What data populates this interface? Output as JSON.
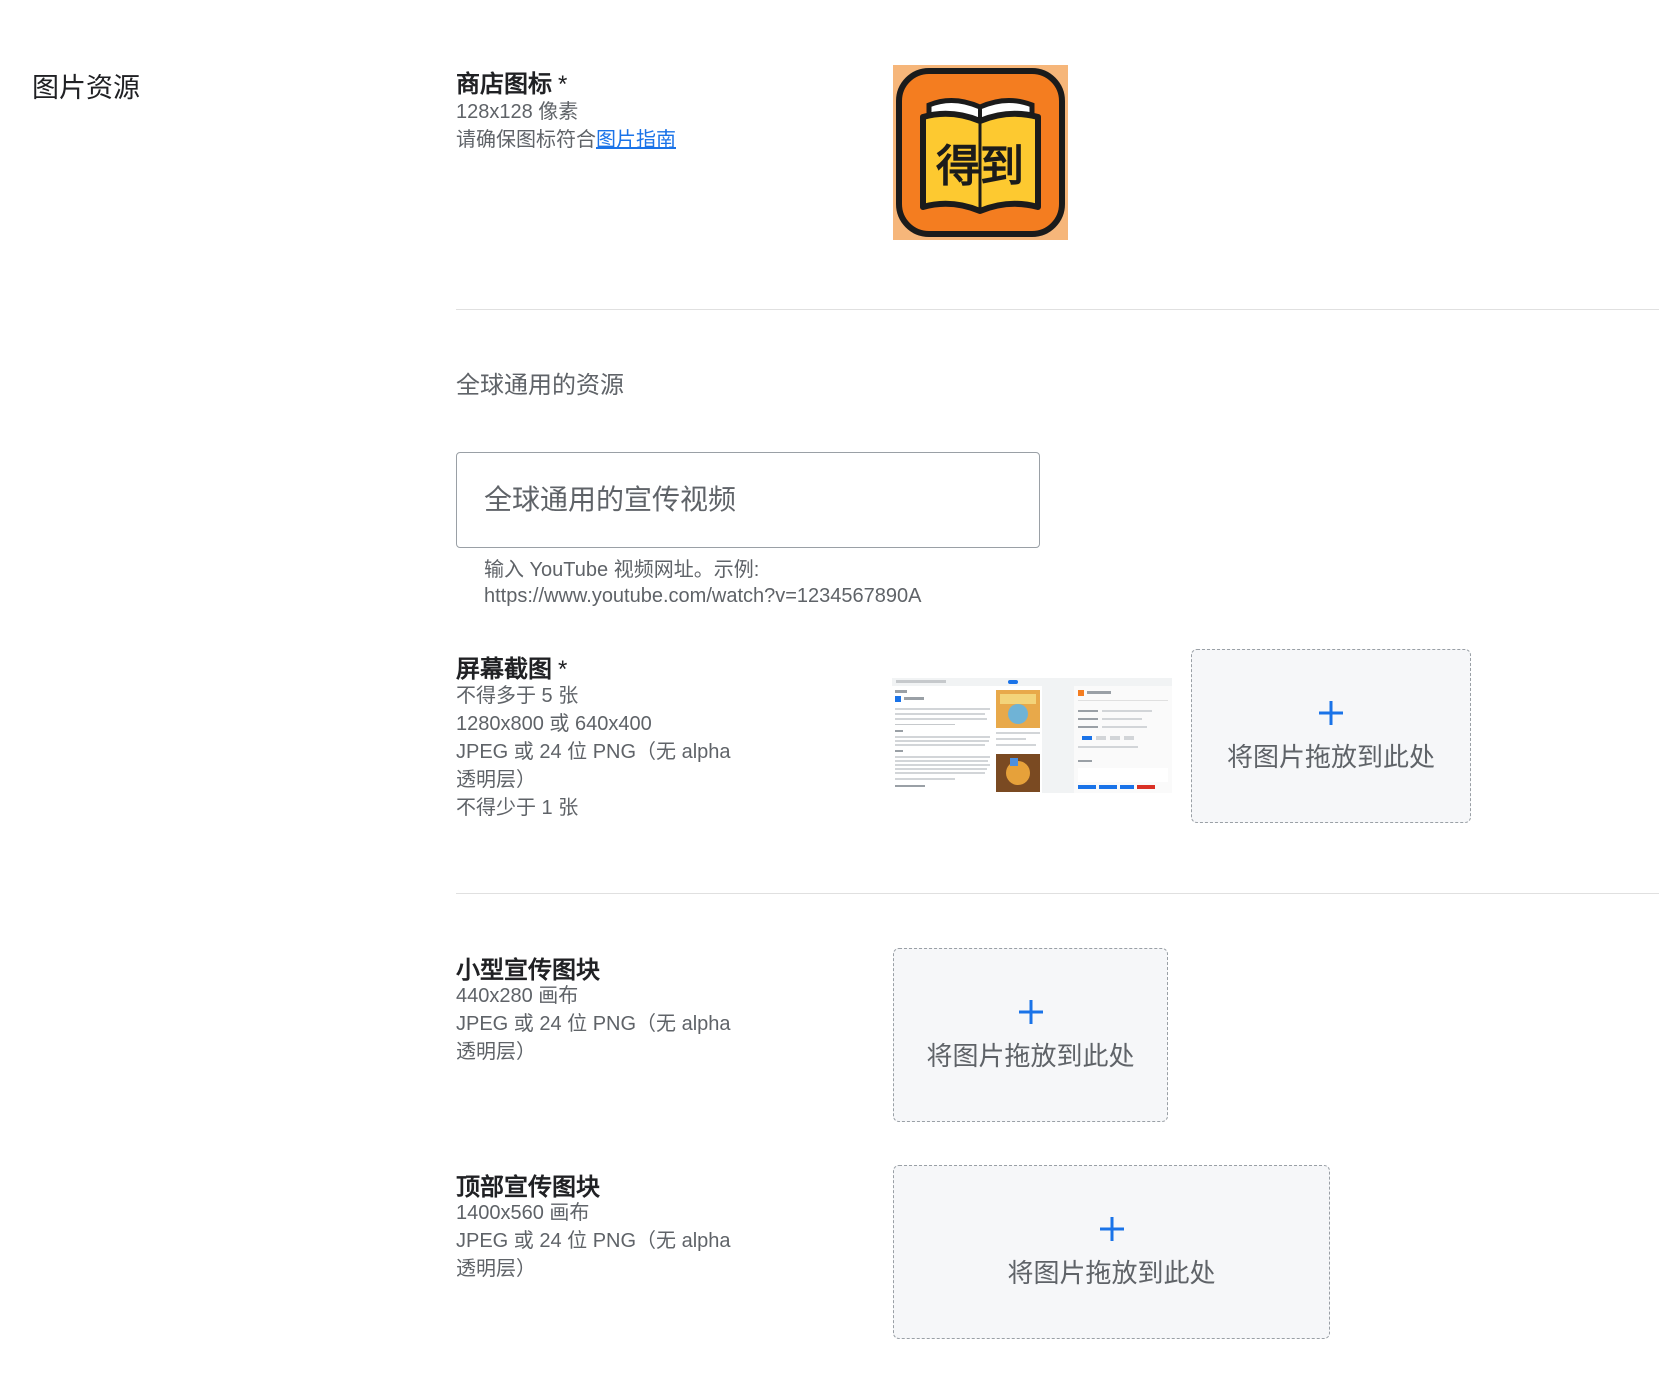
{
  "section": {
    "title": "图片资源"
  },
  "store_icon": {
    "title": "商店图标",
    "required_mark": "*",
    "size_text": "128x128 像素",
    "guide_prefix": "请确保图标符合",
    "guide_link": "图片指南",
    "app_logo_text": "得到",
    "colors": {
      "outer": "#f6b67a",
      "tile": "#f47d20",
      "book": "#fdc930"
    }
  },
  "global_assets": {
    "heading": "全球通用的资源",
    "video_input": {
      "placeholder": "全球通用的宣传视频",
      "value": ""
    },
    "video_help_line1": "输入 YouTube 视频网址。示例:",
    "video_help_line2": "https://www.youtube.com/watch?v=1234567890A"
  },
  "screenshots": {
    "title": "屏幕截图",
    "required_mark": "*",
    "desc": [
      "不得多于 5 张",
      "1280x800 或 640x400",
      "JPEG 或 24 位 PNG（无 alpha 透明层）",
      "不得少于 1 张"
    ],
    "dropzone_label": "将图片拖放到此处"
  },
  "small_promo": {
    "title": "小型宣传图块",
    "desc": [
      "440x280 画布",
      "JPEG 或 24 位 PNG（无 alpha 透明层）"
    ],
    "dropzone_label": "将图片拖放到此处"
  },
  "marquee_promo": {
    "title": "顶部宣传图块",
    "desc": [
      "1400x560 画布",
      "JPEG 或 24 位 PNG（无 alpha 透明层）"
    ],
    "dropzone_label": "将图片拖放到此处"
  },
  "colors": {
    "accent": "#1a73e8",
    "text_primary": "#202124",
    "text_secondary": "#5f6368",
    "divider": "#e0e0e0"
  }
}
